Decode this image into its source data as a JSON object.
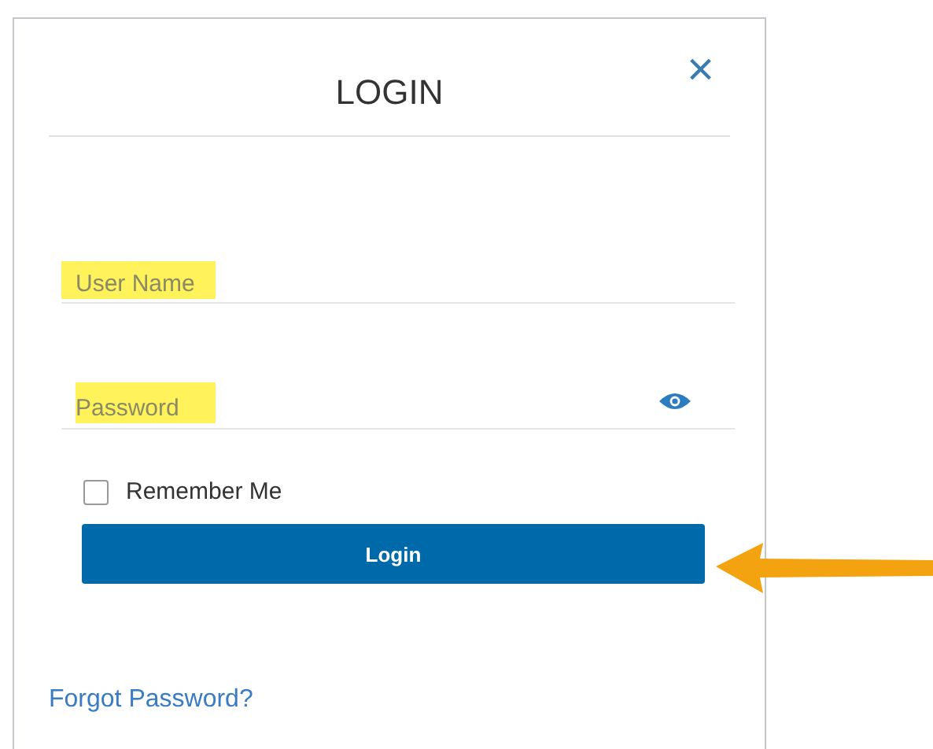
{
  "dialog": {
    "title": "LOGIN",
    "close": "×"
  },
  "fields": [
    {
      "kind": "text",
      "placeholder": "User Name",
      "highlighted": true
    },
    {
      "kind": "password",
      "placeholder": "Password",
      "highlighted": true,
      "reveal_icon": true
    }
  ],
  "remember_me": {
    "label": "Remember Me",
    "checked": false
  },
  "login_button": {
    "label": "Login",
    "pointed_at": true
  },
  "forgot_link": "Forgot Password?"
}
